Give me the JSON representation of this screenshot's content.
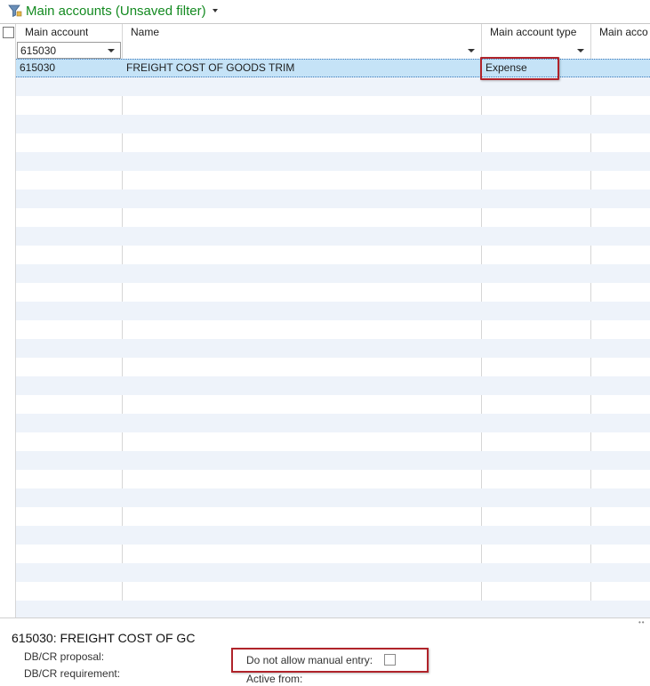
{
  "title": {
    "text": "Main accounts (Unsaved filter)"
  },
  "grid": {
    "columns": [
      "Main account",
      "Name",
      "Main account type",
      "Main acco"
    ],
    "filters": {
      "main_account": "615030",
      "name": "",
      "main_account_type": ""
    },
    "rows": [
      {
        "main_account": "615030",
        "name": "FREIGHT COST OF GOODS TRIM",
        "main_account_type": "Expense",
        "other": ""
      }
    ]
  },
  "detail": {
    "title": "615030: FREIGHT COST OF GC",
    "dbcr_proposal_label": "DB/CR proposal:",
    "dbcr_requirement_label": "DB/CR requirement:",
    "do_not_allow_manual_entry_label": "Do not allow manual entry:",
    "active_from_label": "Active from:"
  },
  "colors": {
    "title_green": "#138a20",
    "selected_row": "#c5e3f7",
    "alt_row": "#eef3fa",
    "highlight_red": "#b0232a"
  }
}
